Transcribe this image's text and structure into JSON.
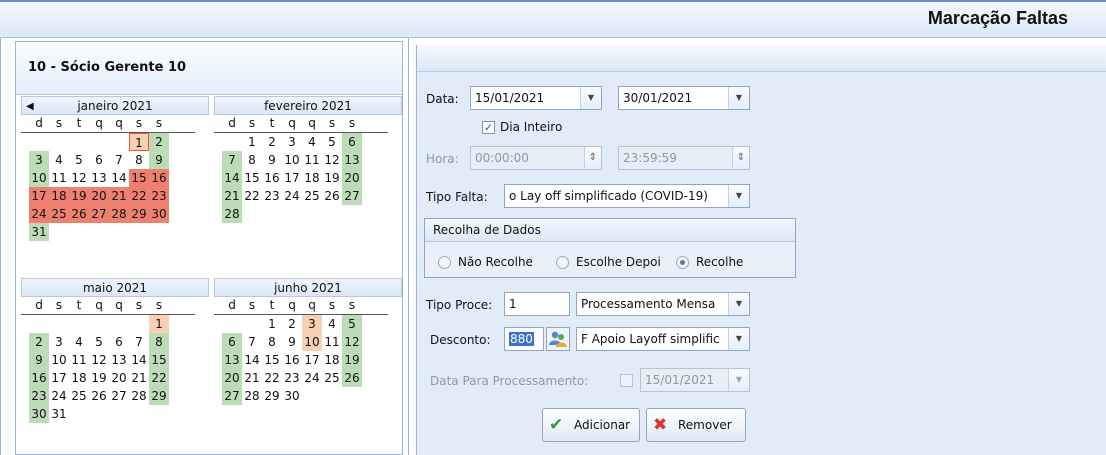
{
  "window": {
    "title": "Marcação Faltas"
  },
  "employee": {
    "name": "10 - Sócio Gerente 10"
  },
  "calendar": {
    "weekday_headers": [
      "d",
      "s",
      "t",
      "q",
      "q",
      "s",
      "s"
    ],
    "months": [
      {
        "title": "janeiro 2021",
        "weeks": [
          [
            "",
            "",
            "",
            "",
            "",
            "1",
            "2"
          ],
          [
            "3",
            "4",
            "5",
            "6",
            "7",
            "8",
            "9"
          ],
          [
            "10",
            "11",
            "12",
            "13",
            "14",
            "15",
            "16"
          ],
          [
            "17",
            "18",
            "19",
            "20",
            "21",
            "22",
            "23"
          ],
          [
            "24",
            "25",
            "26",
            "27",
            "28",
            "29",
            "30"
          ],
          [
            "31",
            "",
            "",
            "",
            "",
            "",
            ""
          ]
        ]
      },
      {
        "title": "fevereiro 2021",
        "weeks": [
          [
            "",
            "1",
            "2",
            "3",
            "4",
            "5",
            "6"
          ],
          [
            "7",
            "8",
            "9",
            "10",
            "11",
            "12",
            "13"
          ],
          [
            "14",
            "15",
            "16",
            "17",
            "18",
            "19",
            "20"
          ],
          [
            "21",
            "22",
            "23",
            "24",
            "25",
            "26",
            "27"
          ],
          [
            "28",
            "",
            "",
            "",
            "",
            "",
            ""
          ]
        ]
      },
      {
        "title": "maio 2021",
        "weeks": [
          [
            "",
            "",
            "",
            "",
            "",
            "",
            "1"
          ],
          [
            "2",
            "3",
            "4",
            "5",
            "6",
            "7",
            "8"
          ],
          [
            "9",
            "10",
            "11",
            "12",
            "13",
            "14",
            "15"
          ],
          [
            "16",
            "17",
            "18",
            "19",
            "20",
            "21",
            "22"
          ],
          [
            "23",
            "24",
            "25",
            "26",
            "27",
            "28",
            "29"
          ],
          [
            "30",
            "31",
            "",
            "",
            "",
            "",
            ""
          ]
        ]
      },
      {
        "title": "junho 2021",
        "weeks": [
          [
            "",
            "",
            "1",
            "2",
            "3",
            "4",
            "5"
          ],
          [
            "6",
            "7",
            "8",
            "9",
            "10",
            "11",
            "12"
          ],
          [
            "13",
            "14",
            "15",
            "16",
            "17",
            "18",
            "19"
          ],
          [
            "20",
            "21",
            "22",
            "23",
            "24",
            "25",
            "26"
          ],
          [
            "27",
            "28",
            "29",
            "30",
            "",
            "",
            ""
          ]
        ]
      }
    ],
    "colors": {
      "weekend": "#bcdcb8",
      "absence": "#ef8070",
      "holiday": "#f9d0b4"
    }
  },
  "form": {
    "data_label": "Data:",
    "data_from": "15/01/2021",
    "data_to": "30/01/2021",
    "dia_inteiro_label": "Dia Inteiro",
    "dia_inteiro_checked": true,
    "hora_label": "Hora:",
    "hora_from": "00:00:00",
    "hora_to": "23:59:59",
    "tipo_falta_label": "Tipo Falta:",
    "tipo_falta_value": "o Lay off simplificado (COVID-19)",
    "recolha": {
      "title": "Recolha de Dados",
      "options": [
        "Não Recolhe",
        "Escolhe Depoi",
        "Recolhe"
      ],
      "selected": "Recolhe"
    },
    "tipo_proce_label": "Tipo Proce:",
    "tipo_proce_code": "1",
    "tipo_proce_value": "Processamento Mensa",
    "desconto_label": "Desconto:",
    "desconto_code": "880",
    "desconto_value": "F Apoio Layoff simplific",
    "data_proc_label": "Data Para Processamento:",
    "data_proc_value": "15/01/2021",
    "add_label": "Adicionar",
    "remove_label": "Remover"
  }
}
